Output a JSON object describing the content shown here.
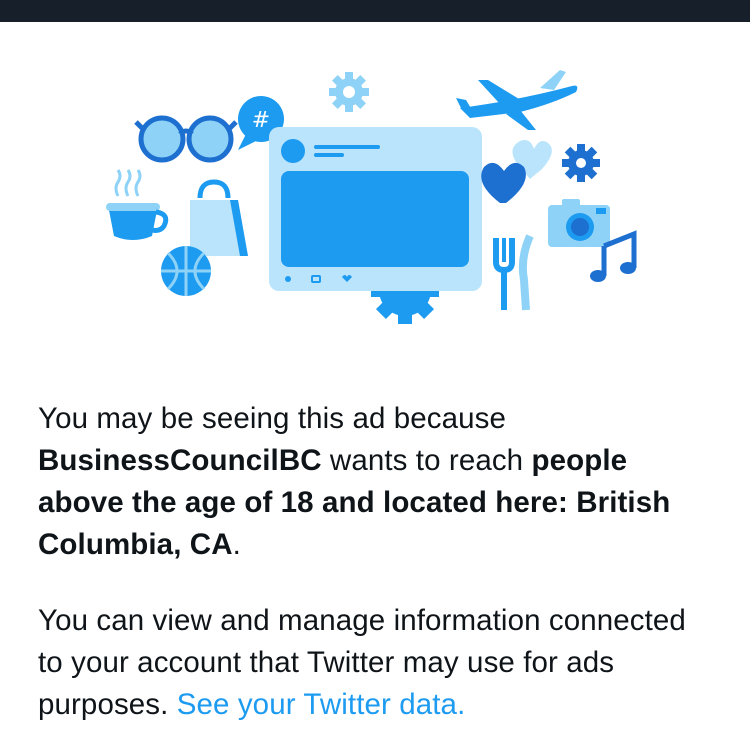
{
  "ad_explanation": {
    "prefix": "You may be seeing this ad because ",
    "advertiser": "BusinessCouncilBC",
    "middle": " wants to reach ",
    "targeting": "people above the age of 18 and located here: British Columbia, CA",
    "suffix": "."
  },
  "data_info": {
    "text": "You can view and manage information connected to your account that Twitter may use for ads purposes. ",
    "link_label": "See your Twitter data."
  },
  "illustration_icons": [
    "sunglasses-icon",
    "hashtag-bubble-icon",
    "gear-icon",
    "airplane-icon",
    "tweet-card-icon",
    "hearts-icon",
    "camera-icon",
    "music-note-icon",
    "coffee-cup-icon",
    "shopping-bag-icon",
    "basketball-icon",
    "fork-knife-icon"
  ],
  "colors": {
    "topbar": "#17202a",
    "primary_blue": "#1d9bf0",
    "light_blue": "#8ed3f7",
    "pale_blue": "#b9e4fb",
    "link": "#1d9bf0",
    "text": "#0f1419"
  }
}
